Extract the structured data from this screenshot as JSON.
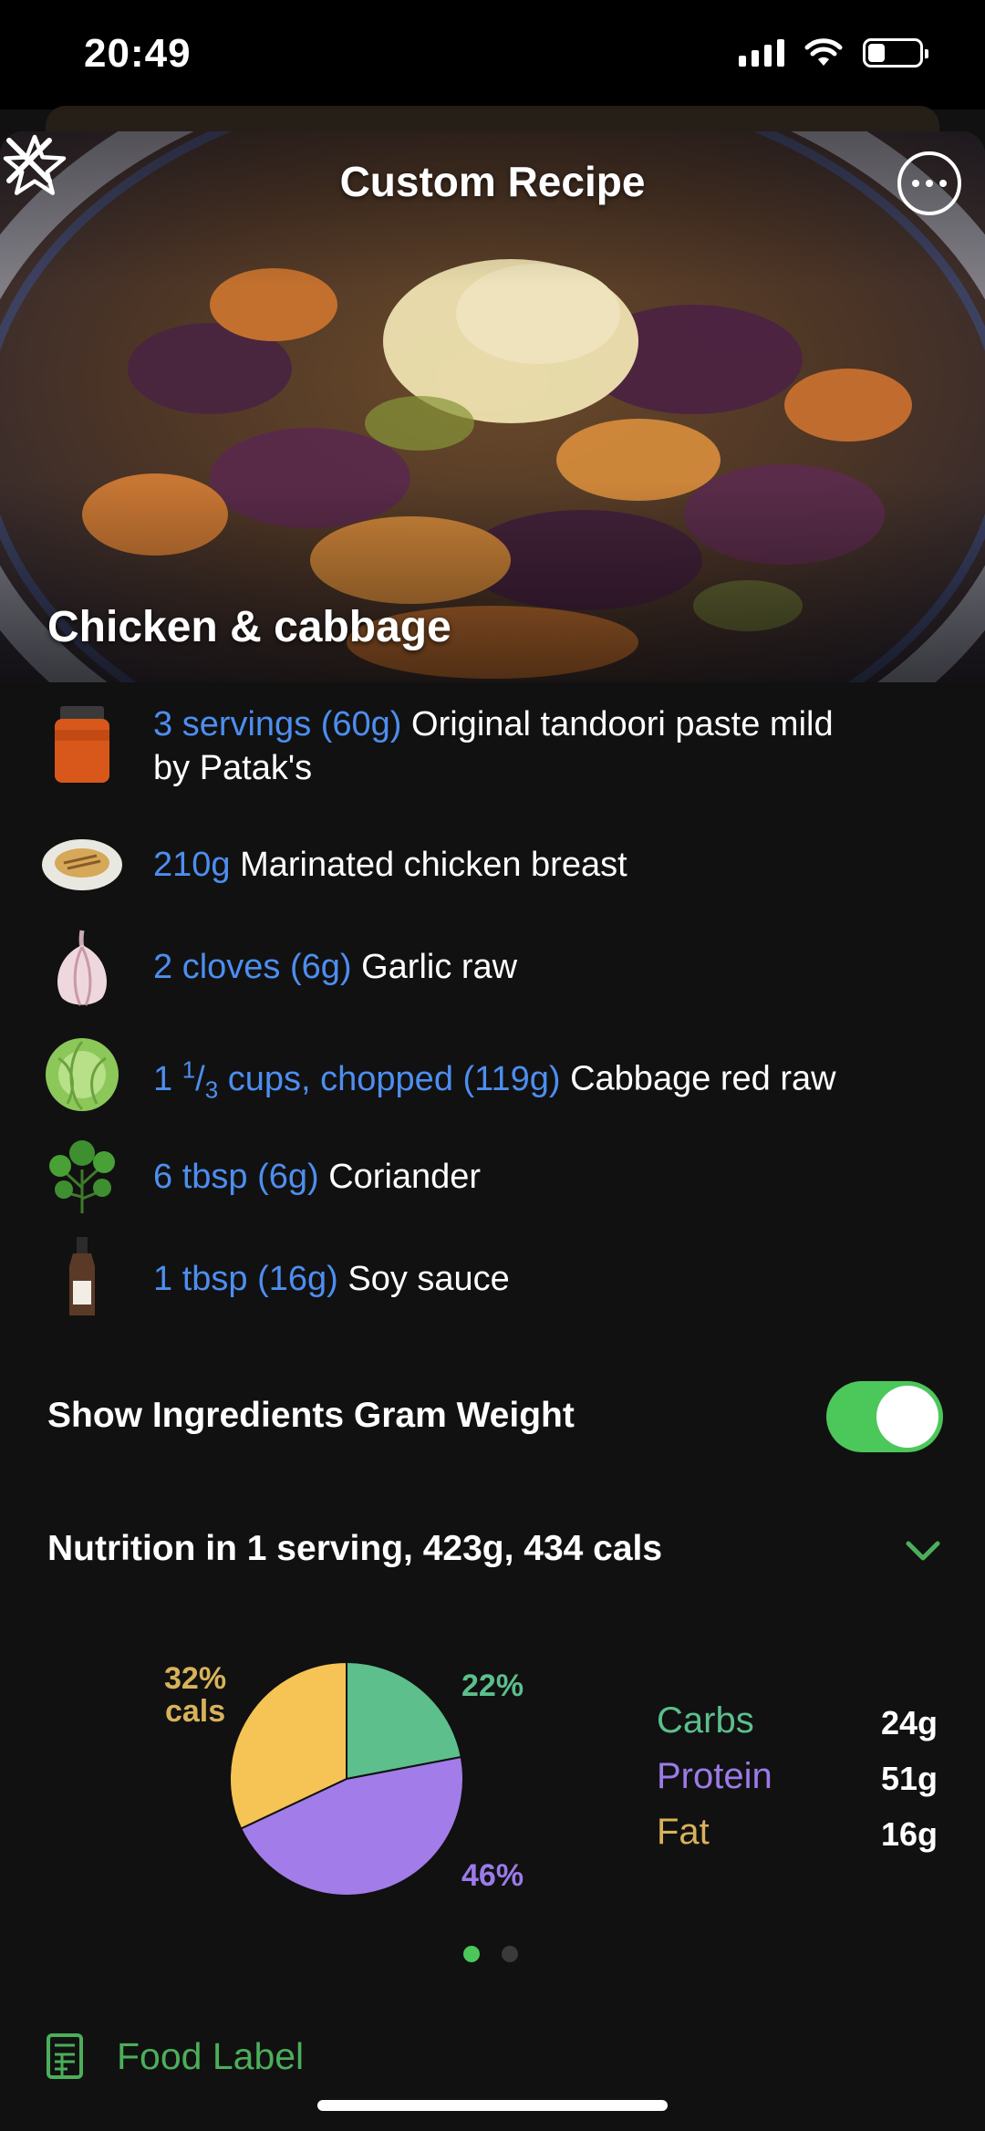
{
  "status_bar": {
    "time": "20:49"
  },
  "header": {
    "title": "Custom Recipe"
  },
  "recipe": {
    "name": "Chicken & cabbage"
  },
  "ingredients": [
    {
      "quantity": "3 servings (60g)",
      "name": "Original tandoori paste mild",
      "name_line2": "by Patak's",
      "icon": "tandoori-paste-jar-icon"
    },
    {
      "quantity": "210g",
      "name": "Marinated chicken breast",
      "icon": "chicken-plate-icon"
    },
    {
      "quantity": "2 cloves (6g)",
      "name": "Garlic raw",
      "icon": "garlic-icon"
    },
    {
      "quantity_prefix": "1 ",
      "quantity_num": "1",
      "quantity_slash": "/",
      "quantity_den": "3",
      "quantity_suffix": " cups, chopped (119g)",
      "name": "Cabbage red raw",
      "icon": "cabbage-icon"
    },
    {
      "quantity": "6 tbsp (6g)",
      "name": "Coriander",
      "icon": "coriander-icon"
    },
    {
      "quantity": "1 tbsp (16g)",
      "name": "Soy sauce",
      "icon": "soy-sauce-bottle-icon"
    }
  ],
  "gram_weight_toggle": {
    "label": "Show Ingredients Gram Weight",
    "on": true
  },
  "nutrition": {
    "title": "Nutrition in 1 serving, 423g, 434 cals",
    "pie_labels": {
      "carbs": "22%",
      "protein": "46%",
      "fat_pct": "32%",
      "fat_unit": "cals"
    },
    "macros": [
      {
        "name": "Carbs",
        "value": "24g",
        "color": "#5cbf8c"
      },
      {
        "name": "Protein",
        "value": "51g",
        "color": "#9c7ae8"
      },
      {
        "name": "Fat",
        "value": "16g",
        "color": "#d8b25a"
      }
    ],
    "page_dots": {
      "count": 2,
      "active": 0
    }
  },
  "chart_data": {
    "type": "pie",
    "categories": [
      "Carbs",
      "Protein",
      "Fat"
    ],
    "values": [
      22,
      46,
      32
    ],
    "colors": [
      "#5cbf8c",
      "#a27ce9",
      "#f5c455"
    ]
  },
  "footer": {
    "food_label": "Food Label"
  },
  "colors": {
    "accent_blue": "#4d8ef0",
    "toggle_green": "#4cc75a",
    "footer_green": "#4cae5a"
  }
}
